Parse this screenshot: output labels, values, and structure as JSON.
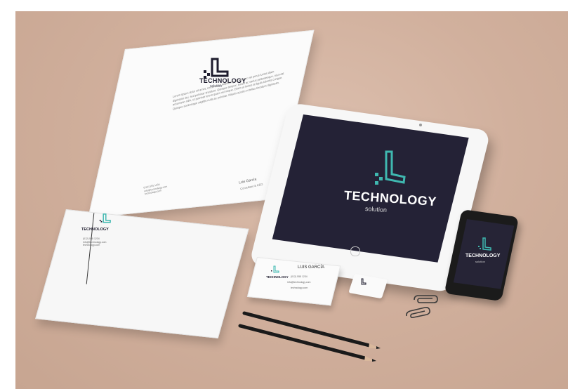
{
  "scene": {
    "colors": {
      "brand_dark": "#242236",
      "brand_teal": "#3fb8b0",
      "background": "#d3b4a1"
    },
    "letterhead": {
      "brand": "TECHNOLOGY",
      "subtitle": "solution",
      "body_text": "Lorem ipsum dolor sit amet, consectetur adipiscing elit. Donec vel purus luctus diam dignissim dui, sed pulvinar tincidunt. Quisque tempor, lectus ac varius pellentesque, nisi erat accumsan nibh, ut pulvinar lorem quam vel neque. Etiam ut lectus at ligula lobortis congue. Quisque scelerisque sagittis nulla ac pulvinar. Mauris a justo et tellus tincidunt dignissim.",
      "signature_name": "Luis García",
      "signature_title": "Consultant & CEO",
      "contact_lines": [
        "(012) 555 1234",
        "info@technology.com",
        "technology.com"
      ]
    },
    "envelope": {
      "brand": "TECHNOLOGY",
      "contact_lines": [
        "(012) 555 1234",
        "info@technology.com",
        "technology.com"
      ]
    },
    "ipad": {
      "brand": "TECHNOLOGY",
      "subtitle": "solution"
    },
    "phone": {
      "brand": "TECHNOLOGY",
      "subtitle": "solution"
    },
    "business_card": {
      "brand": "TECHNOLOGY",
      "name": "LUIS GARCÍA",
      "phone": "(012) 555 1234",
      "email": "info@technology.com",
      "site": "technology.com"
    },
    "icons": [
      "logo-l-icon",
      "paperclip-icon",
      "pencil-icon",
      "home-button-icon"
    ]
  }
}
